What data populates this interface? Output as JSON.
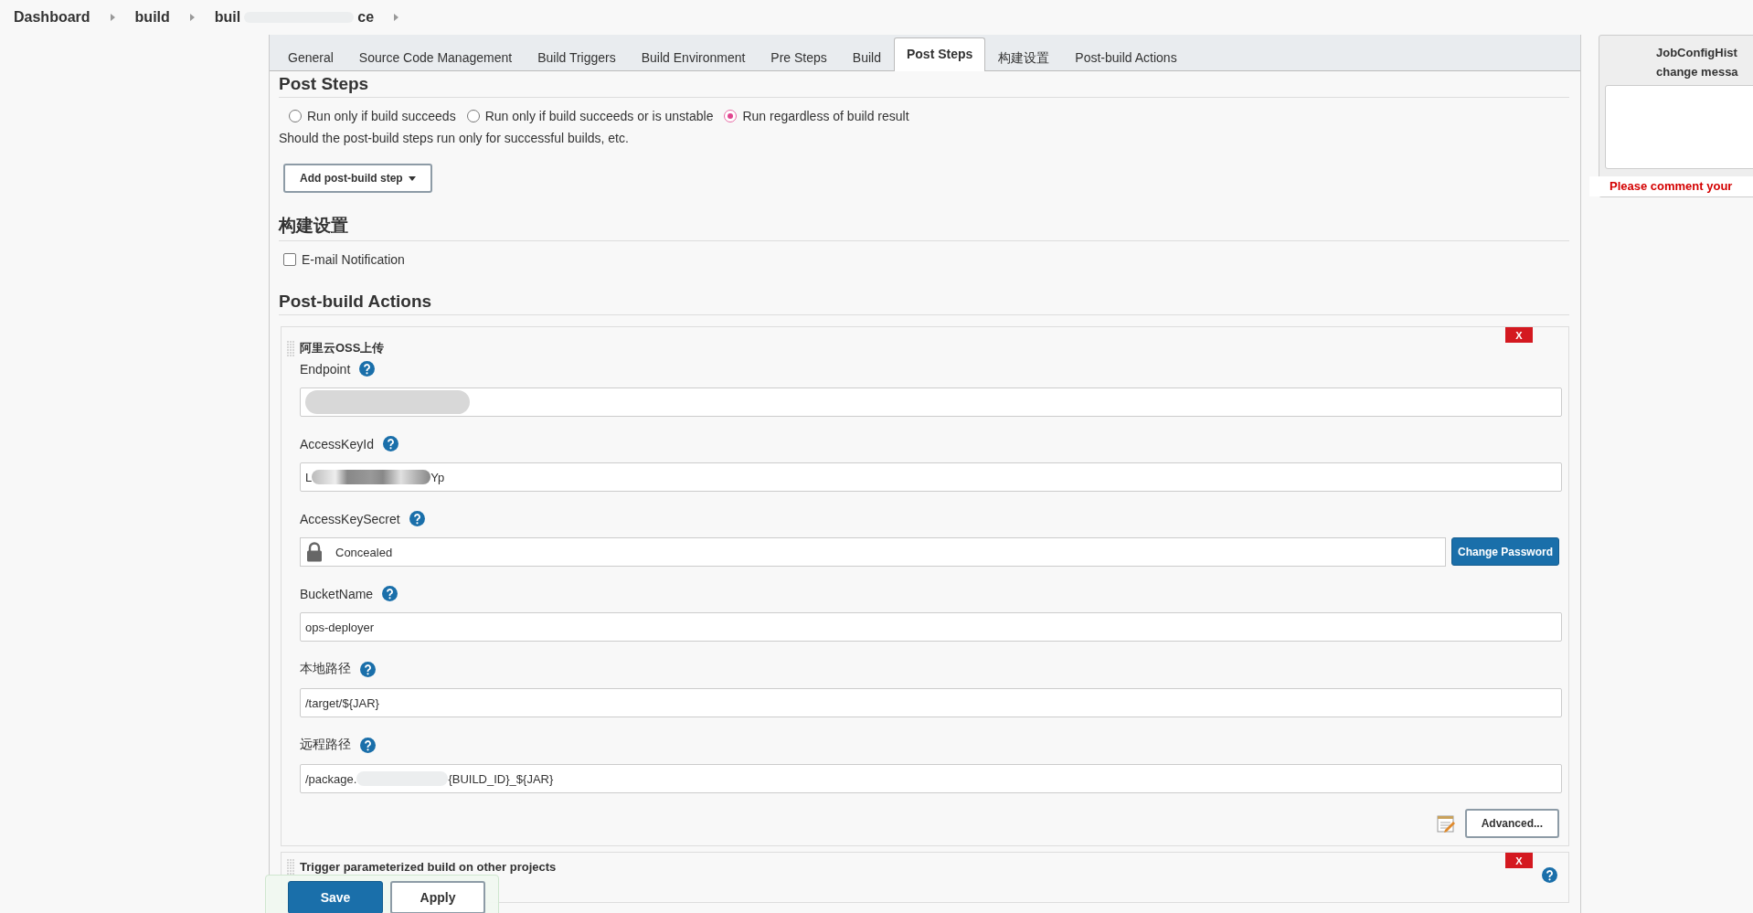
{
  "breadcrumbs": [
    {
      "label": "Dashboard"
    },
    {
      "label": "build"
    },
    {
      "label": "buil",
      "label_end": "ce",
      "redacted": true
    }
  ],
  "tabs": [
    {
      "label": "General",
      "selected": false
    },
    {
      "label": "Source Code Management",
      "selected": false
    },
    {
      "label": "Build Triggers",
      "selected": false
    },
    {
      "label": "Build Environment",
      "selected": false
    },
    {
      "label": "Pre Steps",
      "selected": false
    },
    {
      "label": "Build",
      "selected": false
    },
    {
      "label": "Post Steps",
      "selected": true
    },
    {
      "label": "构建设置",
      "selected": false
    },
    {
      "label": "Post-build Actions",
      "selected": false
    }
  ],
  "post_steps": {
    "heading": "Post Steps",
    "options": [
      {
        "label": "Run only if build succeeds",
        "selected": false
      },
      {
        "label": "Run only if build succeeds or is unstable",
        "selected": false
      },
      {
        "label": "Run regardless of build result",
        "selected": true
      }
    ],
    "description": "Should the post-build steps run only for successful builds, etc.",
    "add_button": "Add post-build step"
  },
  "build_settings": {
    "heading": "构建设置",
    "checkbox": {
      "label": "E-mail Notification",
      "checked": false
    }
  },
  "post_build_actions": {
    "heading": "Post-build Actions",
    "cards": [
      {
        "title": "阿里云OSS上传",
        "delete": "X",
        "fields": [
          {
            "label": "Endpoint",
            "kind": "redacted"
          },
          {
            "label": "AccessKeyId",
            "kind": "redacted",
            "value": "L",
            "value_end": "Yp"
          },
          {
            "label": "AccessKeySecret",
            "kind": "password",
            "value": "Concealed",
            "button": "Change Password"
          },
          {
            "label": "BucketName",
            "kind": "text",
            "value": "ops-deployer"
          },
          {
            "label": "本地路径",
            "kind": "text",
            "value": "/target/${JAR}"
          },
          {
            "label": "远程路径",
            "kind": "redacted",
            "value": "/package.",
            "value_end": "{BUILD_ID}_${JAR}"
          }
        ],
        "advanced": "Advanced..."
      },
      {
        "title": "Trigger parameterized build on other projects",
        "delete": "X"
      }
    ]
  },
  "side_panel": {
    "title": "JobConfigHist",
    "subtitle": "change messa",
    "warning": "Please comment your"
  },
  "bottom_bar": {
    "buttons": [
      {
        "label": "Save",
        "primary": true
      },
      {
        "label": "Apply",
        "primary": false
      }
    ]
  }
}
